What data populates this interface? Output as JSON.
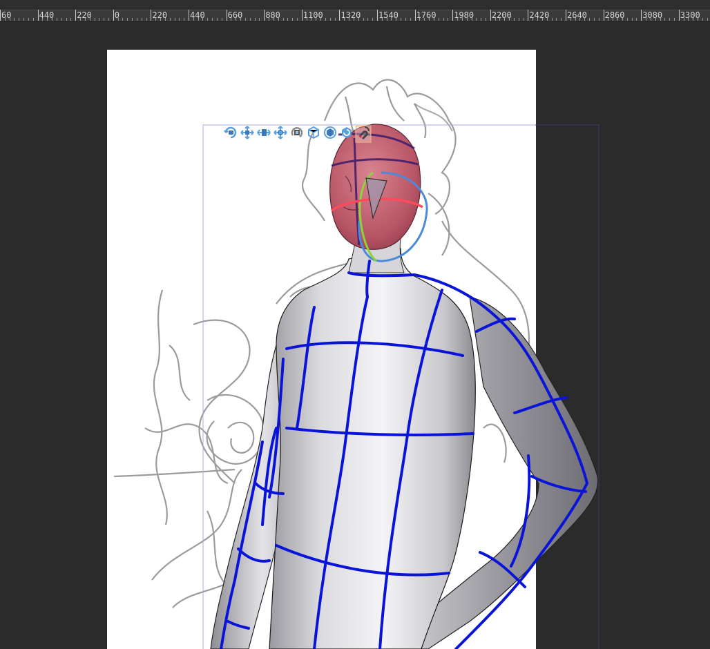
{
  "ruler": {
    "labels": [
      "60",
      "440",
      "220",
      "0",
      "220",
      "440",
      "660",
      "880",
      "1100",
      "1320",
      "1540",
      "1760",
      "1980",
      "2200",
      "2420",
      "2640",
      "2860",
      "3080",
      "3300"
    ]
  },
  "gizmo_toolbar": {
    "tools": [
      {
        "name": "camera-rotate-icon",
        "active": false
      },
      {
        "name": "camera-pan-icon",
        "active": false
      },
      {
        "name": "camera-dolly-icon",
        "active": false
      },
      {
        "name": "move-object-icon",
        "active": false
      },
      {
        "name": "rotate-object-icon",
        "active": false
      },
      {
        "name": "rotate-view-icon",
        "active": false
      },
      {
        "name": "ground-rotate-icon",
        "active": false
      },
      {
        "name": "reset-icon",
        "active": false
      },
      {
        "name": "magnet-snap-icon",
        "active": true
      }
    ]
  },
  "colors": {
    "background": "#2b2b2b",
    "paper": "#ffffff",
    "grid_lines": "#0a14d8",
    "selected_part": "#c9606e",
    "gizmo_red": "#ff4a5a",
    "gizmo_green": "#8fd23a",
    "gizmo_blue": "#4a8ad8",
    "sketch": "#8a8a8a"
  }
}
